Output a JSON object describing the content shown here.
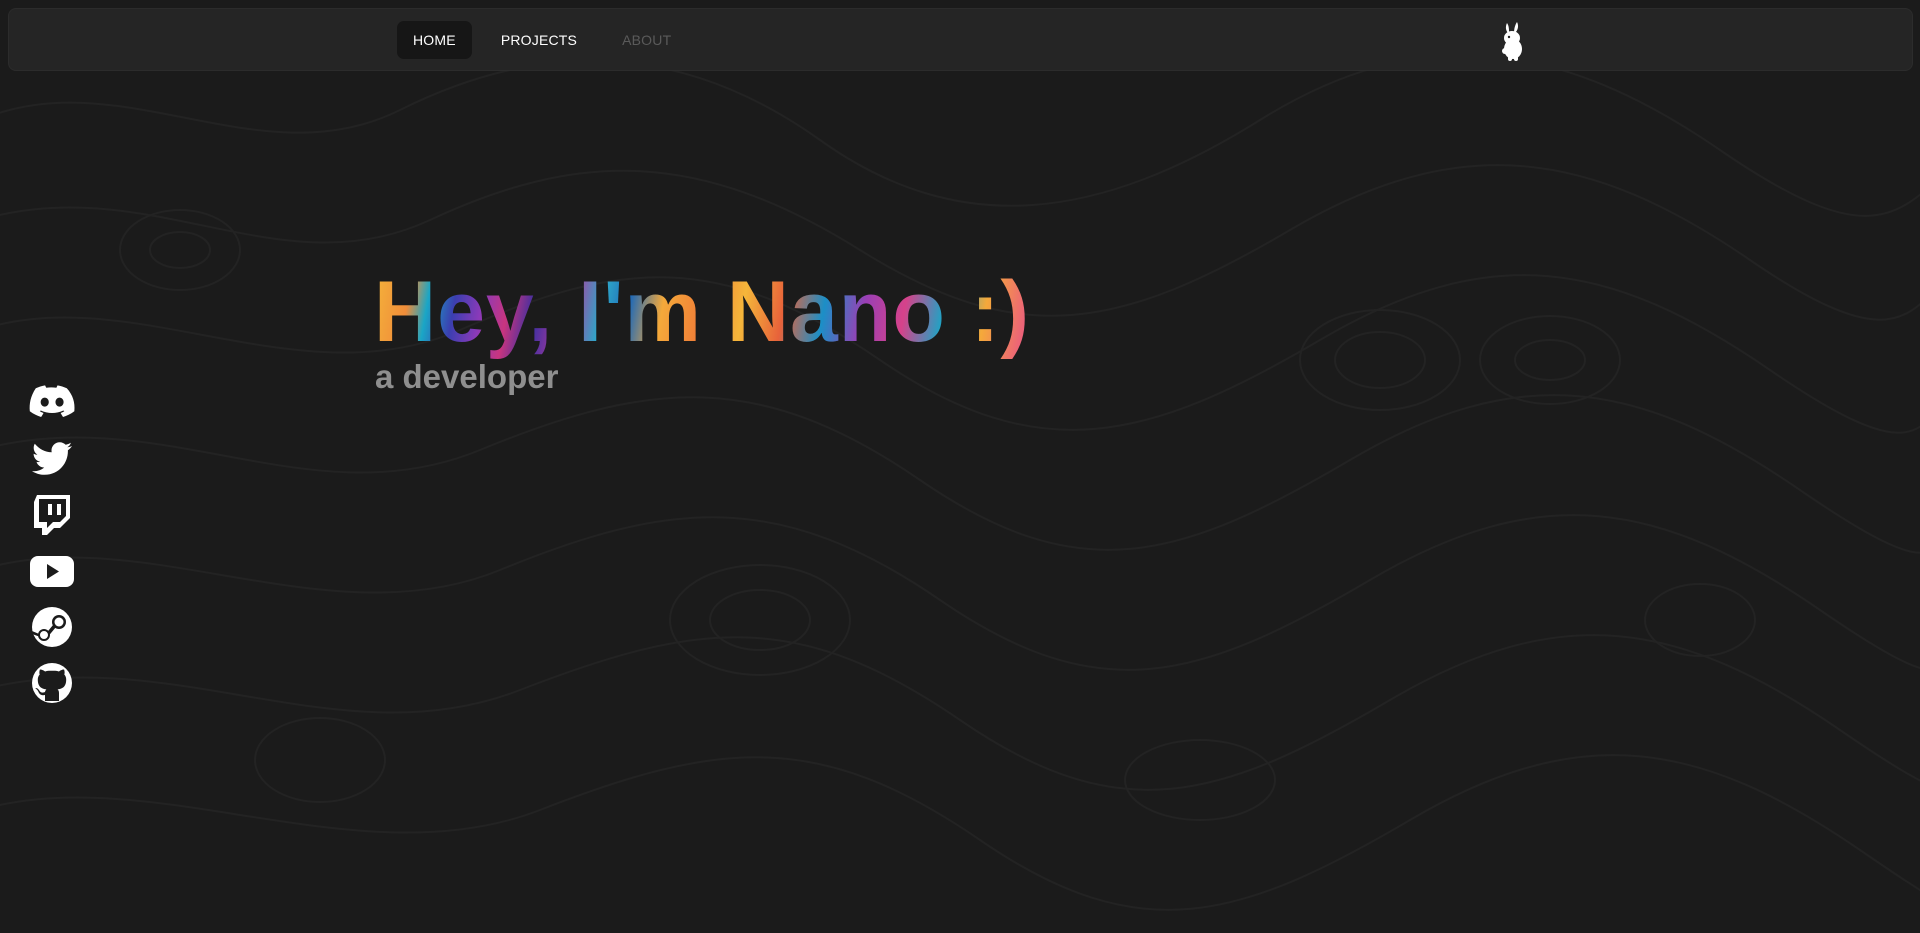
{
  "nav": {
    "items": [
      {
        "label": "HOME",
        "state": "active"
      },
      {
        "label": "PROJECTS",
        "state": "normal"
      },
      {
        "label": "ABOUT",
        "state": "disabled"
      }
    ],
    "logo_icon": "rabbit-icon"
  },
  "hero": {
    "title": "Hey, I'm Nano :)",
    "subtitle": "a developer"
  },
  "socials": [
    {
      "icon": "discord-icon"
    },
    {
      "icon": "twitter-icon"
    },
    {
      "icon": "twitch-icon"
    },
    {
      "icon": "youtube-icon"
    },
    {
      "icon": "steam-icon"
    },
    {
      "icon": "github-icon"
    }
  ],
  "colors": {
    "background": "#1b1b1b",
    "navbar": "#252525",
    "active_tab": "#161616",
    "subtitle": "#8f8f8f",
    "disabled_link": "#5a5a5a"
  }
}
